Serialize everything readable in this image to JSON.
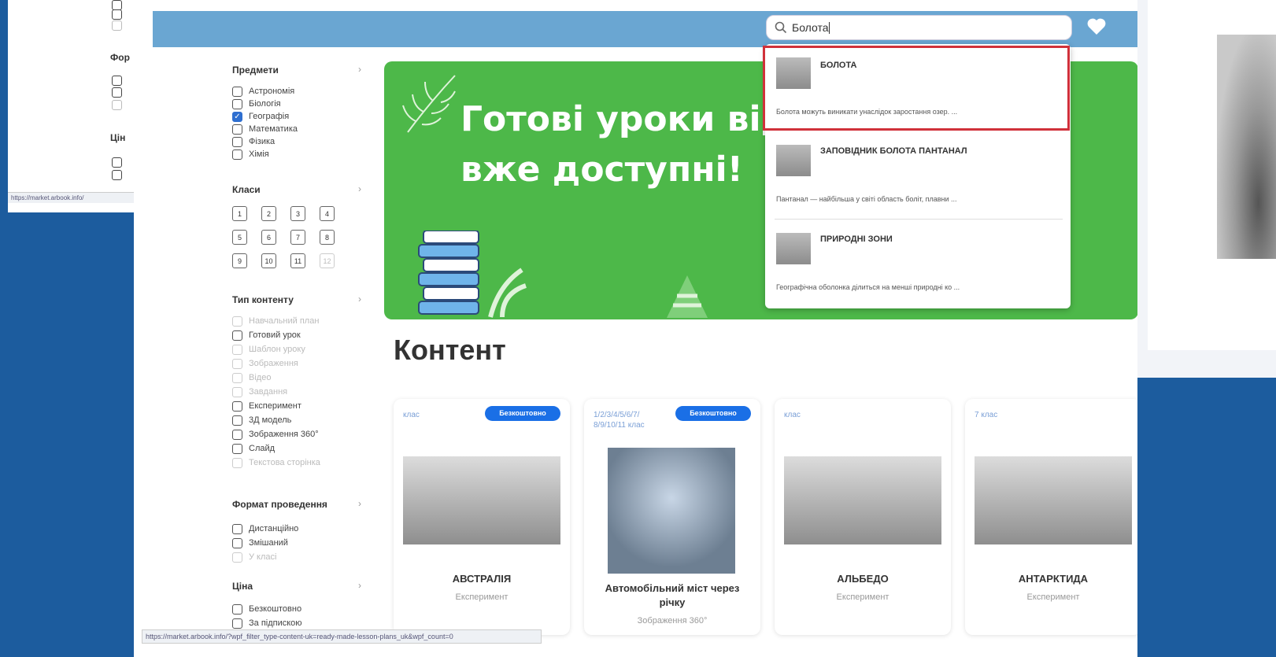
{
  "back_window": {
    "section_1": "Фор",
    "section_2": "Цін",
    "status_url": "https://market.arbook.info/"
  },
  "header": {
    "search_value": "Болота"
  },
  "sidebar": {
    "subjects": {
      "title": "Предмети",
      "items": [
        {
          "label": "Астрономія",
          "checked": false
        },
        {
          "label": "Біологія",
          "checked": false
        },
        {
          "label": "Географія",
          "checked": true
        },
        {
          "label": "Математика",
          "checked": false
        },
        {
          "label": "Фізика",
          "checked": false
        },
        {
          "label": "Хімія",
          "checked": false
        }
      ]
    },
    "grades": {
      "title": "Класи",
      "items": [
        "1",
        "2",
        "3",
        "4",
        "5",
        "6",
        "7",
        "8",
        "9",
        "10",
        "11",
        "12"
      ]
    },
    "content_type": {
      "title": "Тип контенту",
      "items": [
        {
          "label": "Навчальний план",
          "dim": true
        },
        {
          "label": "Готовий урок",
          "dim": false
        },
        {
          "label": "Шаблон уроку",
          "dim": true
        },
        {
          "label": "Зображення",
          "dim": true
        },
        {
          "label": "Відео",
          "dim": true
        },
        {
          "label": "Завдання",
          "dim": true
        },
        {
          "label": "Експеримент",
          "dim": false
        },
        {
          "label": "3Д модель",
          "dim": false
        },
        {
          "label": "Зображення 360°",
          "dim": false
        },
        {
          "label": "Слайд",
          "dim": false
        },
        {
          "label": "Текстова сторінка",
          "dim": true
        }
      ]
    },
    "format": {
      "title": "Формат проведення",
      "items": [
        {
          "label": "Дистанційно",
          "dim": false
        },
        {
          "label": "Змішаний",
          "dim": false
        },
        {
          "label": "У класі",
          "dim": true
        }
      ]
    },
    "price": {
      "title": "Ціна",
      "items": [
        {
          "label": "Безкоштовно",
          "dim": false
        },
        {
          "label": "За підпискою",
          "dim": false
        }
      ]
    }
  },
  "banner": {
    "title_line1": "Готові уроки від",
    "title_line2": "вже доступні!"
  },
  "search_results": [
    {
      "title": "БОЛОТА",
      "desc": "Болота можуть виникати унаслідок заростання озер. ..."
    },
    {
      "title": "ЗАПОВІДНИК БОЛОТА ПАНТАНАЛ",
      "desc": "Пантанал — найбільша у світі область боліт, плавни ..."
    },
    {
      "title": "ПРИРОДНІ ЗОНИ",
      "desc": "Географічна оболонка ділиться на менші природні ко ..."
    }
  ],
  "content": {
    "title": "Контент",
    "cards": [
      {
        "grade": "клас",
        "badge": "Безкоштовно",
        "title": "АВСТРАЛІЯ",
        "type": "Експеримент"
      },
      {
        "grade": "1/2/3/4/5/6/7/\n8/9/10/11 клас",
        "badge": "Безкоштовно",
        "title": "Автомобільний міст через річку",
        "type": "Зображення 360°"
      },
      {
        "grade": "клас",
        "badge": "",
        "title": "АЛЬБЕДО",
        "type": "Експеримент"
      },
      {
        "grade": "7 клас",
        "badge": "",
        "title": "АНТАРКТИДА",
        "type": "Експеримент"
      }
    ]
  },
  "statusbar": {
    "url": "https://market.arbook.info/?wpf_filter_type-content-uk=ready-made-lesson-plans_uk&wpf_count=0"
  }
}
